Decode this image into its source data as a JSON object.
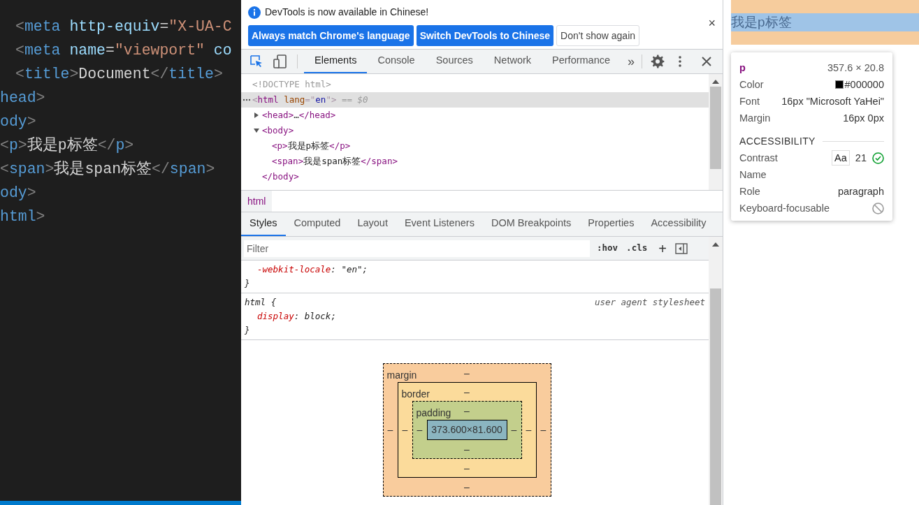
{
  "editor": {
    "lines": [
      {
        "segments": [
          {
            "text": "<",
            "kind": "punct"
          },
          {
            "text": "meta",
            "kind": "tag"
          },
          {
            "text": " http-equiv",
            "kind": "attr"
          },
          {
            "text": "=",
            "kind": "text"
          },
          {
            "text": "\"X-UA-C",
            "kind": "string"
          }
        ],
        "indent": true
      },
      {
        "segments": [
          {
            "text": "<",
            "kind": "punct"
          },
          {
            "text": "meta",
            "kind": "tag"
          },
          {
            "text": " name",
            "kind": "attr"
          },
          {
            "text": "=",
            "kind": "text"
          },
          {
            "text": "\"viewport\"",
            "kind": "string"
          },
          {
            "text": " co",
            "kind": "attr"
          }
        ],
        "indent": true
      },
      {
        "segments": [
          {
            "text": "<",
            "kind": "punct"
          },
          {
            "text": "title",
            "kind": "tag"
          },
          {
            "text": ">",
            "kind": "punct"
          },
          {
            "text": "Document",
            "kind": "text"
          },
          {
            "text": "</",
            "kind": "punct"
          },
          {
            "text": "title",
            "kind": "tag"
          },
          {
            "text": ">",
            "kind": "punct"
          }
        ],
        "indent": true
      },
      {
        "segments": [
          {
            "text": "head",
            "kind": "tag"
          },
          {
            "text": ">",
            "kind": "punct"
          }
        ],
        "indent": false
      },
      {
        "segments": [
          {
            "text": "ody",
            "kind": "tag"
          },
          {
            "text": ">",
            "kind": "punct"
          }
        ],
        "indent": false
      },
      {
        "segments": [
          {
            "text": "<",
            "kind": "punct"
          },
          {
            "text": "p",
            "kind": "tag"
          },
          {
            "text": ">",
            "kind": "punct"
          },
          {
            "text": "我是p标签",
            "kind": "text"
          },
          {
            "text": "</",
            "kind": "punct"
          },
          {
            "text": "p",
            "kind": "tag"
          },
          {
            "text": ">",
            "kind": "punct"
          }
        ],
        "indent": false
      },
      {
        "segments": [
          {
            "text": "<",
            "kind": "punct"
          },
          {
            "text": "span",
            "kind": "tag"
          },
          {
            "text": ">",
            "kind": "punct"
          },
          {
            "text": "我是span标签",
            "kind": "text"
          },
          {
            "text": "</",
            "kind": "punct"
          },
          {
            "text": "span",
            "kind": "tag"
          },
          {
            "text": ">",
            "kind": "punct"
          }
        ],
        "indent": false
      },
      {
        "segments": [
          {
            "text": "ody",
            "kind": "tag"
          },
          {
            "text": ">",
            "kind": "punct"
          }
        ],
        "indent": false
      },
      {
        "segments": [
          {
            "text": "html",
            "kind": "tag"
          },
          {
            "text": ">",
            "kind": "punct"
          }
        ],
        "indent": false
      }
    ]
  },
  "infobar": {
    "message": "DevTools is now available in Chinese!",
    "buttons": [
      {
        "label": "Always match Chrome's language",
        "primary": true
      },
      {
        "label": "Switch DevTools to Chinese",
        "primary": true
      },
      {
        "label": "Don't show again",
        "primary": false
      }
    ],
    "close": "×"
  },
  "toolbar": {
    "tabs": [
      {
        "label": "Elements",
        "selected": true
      },
      {
        "label": "Console",
        "selected": false
      },
      {
        "label": "Sources",
        "selected": false
      },
      {
        "label": "Network",
        "selected": false
      },
      {
        "label": "Performance",
        "selected": false
      }
    ],
    "more": "»"
  },
  "tree": [
    {
      "segments": [
        {
          "text": "<!DOCTYPE html>",
          "kind": "meta"
        }
      ],
      "selected": false
    },
    {
      "segments": [
        {
          "text": "<",
          "kind": "punct"
        },
        {
          "text": "html",
          "kind": "tag"
        },
        {
          "text": " lang",
          "kind": "attr"
        },
        {
          "text": "=\"",
          "kind": "punct"
        },
        {
          "text": "en",
          "kind": "val"
        },
        {
          "text": "\">",
          "kind": "punct"
        },
        {
          "text": " == $0",
          "kind": "meta"
        }
      ],
      "selected": true,
      "children": [
        {
          "segments": [
            {
              "text": "<head>",
              "kind": "tag"
            },
            {
              "text": "…",
              "kind": "text"
            },
            {
              "text": "</head>",
              "kind": "tag"
            }
          ],
          "selected": false,
          "expanded": false
        },
        {
          "segments": [
            {
              "text": "<body>",
              "kind": "tag"
            }
          ],
          "selected": false,
          "expanded": true,
          "children": [
            {
              "segments": [
                {
                  "text": "<p>",
                  "kind": "tag"
                },
                {
                  "text": "我是p标签",
                  "kind": "text"
                },
                {
                  "text": "</p>",
                  "kind": "tag"
                }
              ],
              "selected": false
            },
            {
              "segments": [
                {
                  "text": "<span>",
                  "kind": "tag"
                },
                {
                  "text": "我是span标签",
                  "kind": "text"
                },
                {
                  "text": "</span>",
                  "kind": "tag"
                }
              ],
              "selected": false
            }
          ]
        },
        {
          "segments": [
            {
              "text": "</body>",
              "kind": "tag"
            }
          ],
          "selected": false
        }
      ]
    }
  ],
  "breadcrumb": [
    "html"
  ],
  "styles_tabs": [
    {
      "label": "Styles",
      "selected": true
    },
    {
      "label": "Computed",
      "selected": false
    },
    {
      "label": "Layout",
      "selected": false
    },
    {
      "label": "Event Listeners",
      "selected": false
    },
    {
      "label": "DOM Breakpoints",
      "selected": false
    },
    {
      "label": "Properties",
      "selected": false
    },
    {
      "label": "Accessibility",
      "selected": false
    }
  ],
  "filter": {
    "placeholder": "Filter",
    "hov": ":hov",
    "cls": ".cls",
    "add": "+"
  },
  "rules": [
    {
      "properties": [
        {
          "name": "-webkit-locale",
          "sep": ":",
          "value": "\"en\"",
          "end": ";"
        }
      ],
      "close": "}"
    },
    {
      "selector": "html {",
      "source": "user agent stylesheet",
      "properties": [
        {
          "name": "display",
          "sep": ":",
          "value": "block",
          "end": ";"
        }
      ],
      "close": "}"
    }
  ],
  "box_model": {
    "margin": {
      "label": "margin",
      "top": "–",
      "right": "–",
      "bottom": "–",
      "left": "–"
    },
    "border": {
      "label": "border",
      "top": "–",
      "right": "–",
      "bottom": "–",
      "left": "–"
    },
    "padding": {
      "label": "padding",
      "top": "–",
      "right": "–",
      "bottom": "–",
      "left": "–"
    },
    "content": "373.600×81.600"
  },
  "page": {
    "paragraph": "我是p标签"
  },
  "tooltip": {
    "tag": "p",
    "size": "357.6 × 20.8",
    "rows": [
      {
        "label": "Color",
        "value": "#000000",
        "kind": "color"
      },
      {
        "label": "Font",
        "value": "16px \"Microsoft YaHei\""
      },
      {
        "label": "Margin",
        "value": "16px 0px"
      }
    ],
    "section": "ACCESSIBILITY",
    "a11y": [
      {
        "label": "Contrast",
        "kind": "contrast",
        "sample": "Aa",
        "value": "21"
      },
      {
        "label": "Name",
        "kind": "text"
      },
      {
        "label": "Role",
        "kind": "text",
        "value": "paragraph"
      },
      {
        "label": "Keyboard-focusable",
        "kind": "blocked"
      }
    ]
  }
}
